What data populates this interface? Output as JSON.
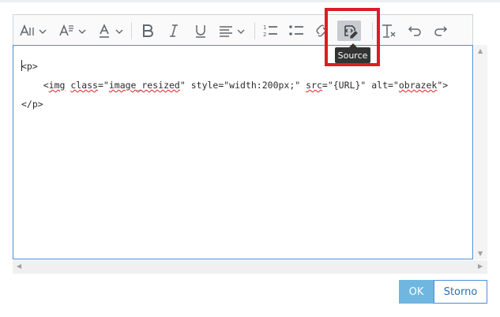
{
  "toolbar": {
    "items": [
      {
        "name": "font-size-dropdown",
        "icon": "font-size-icon"
      },
      {
        "name": "heading-dropdown",
        "icon": "heading-icon"
      },
      {
        "name": "font-color-dropdown",
        "icon": "font-color-icon"
      },
      {
        "name": "bold-button",
        "icon": "bold-icon"
      },
      {
        "name": "italic-button",
        "icon": "italic-icon"
      },
      {
        "name": "underline-button",
        "icon": "underline-icon"
      },
      {
        "name": "align-dropdown",
        "icon": "align-icon"
      },
      {
        "name": "numbered-list-button",
        "icon": "numbered-list-icon"
      },
      {
        "name": "bulleted-list-button",
        "icon": "bulleted-list-icon"
      },
      {
        "name": "link-button",
        "icon": "link-icon"
      },
      {
        "name": "source-button",
        "icon": "source-icon"
      },
      {
        "name": "remove-format-button",
        "icon": "remove-format-icon"
      },
      {
        "name": "undo-button",
        "icon": "undo-icon"
      },
      {
        "name": "redo-button",
        "icon": "redo-icon"
      }
    ],
    "tooltip": "Source"
  },
  "editor": {
    "line1": "<p>",
    "line2": {
      "indent": "    ",
      "open": "<",
      "tag": "img",
      "sp1": " ",
      "attr_class": "class",
      "eq1": "=\"",
      "class_value": "image_resized",
      "q1": "\"",
      "style_attr": " style=\"width:200px;\" ",
      "attr_src": "src",
      "src_rest": "=\"{URL}\" alt=\"",
      "alt_value": "obrazek",
      "close": "\">"
    },
    "line3": "</p>"
  },
  "buttons": {
    "ok_label": "OK",
    "cancel_label": "Storno"
  },
  "colors": {
    "accent": "#4a90d9",
    "ok_bg": "#6fb6e0",
    "highlight": "#e01b24",
    "tooltip_bg": "#333333"
  }
}
